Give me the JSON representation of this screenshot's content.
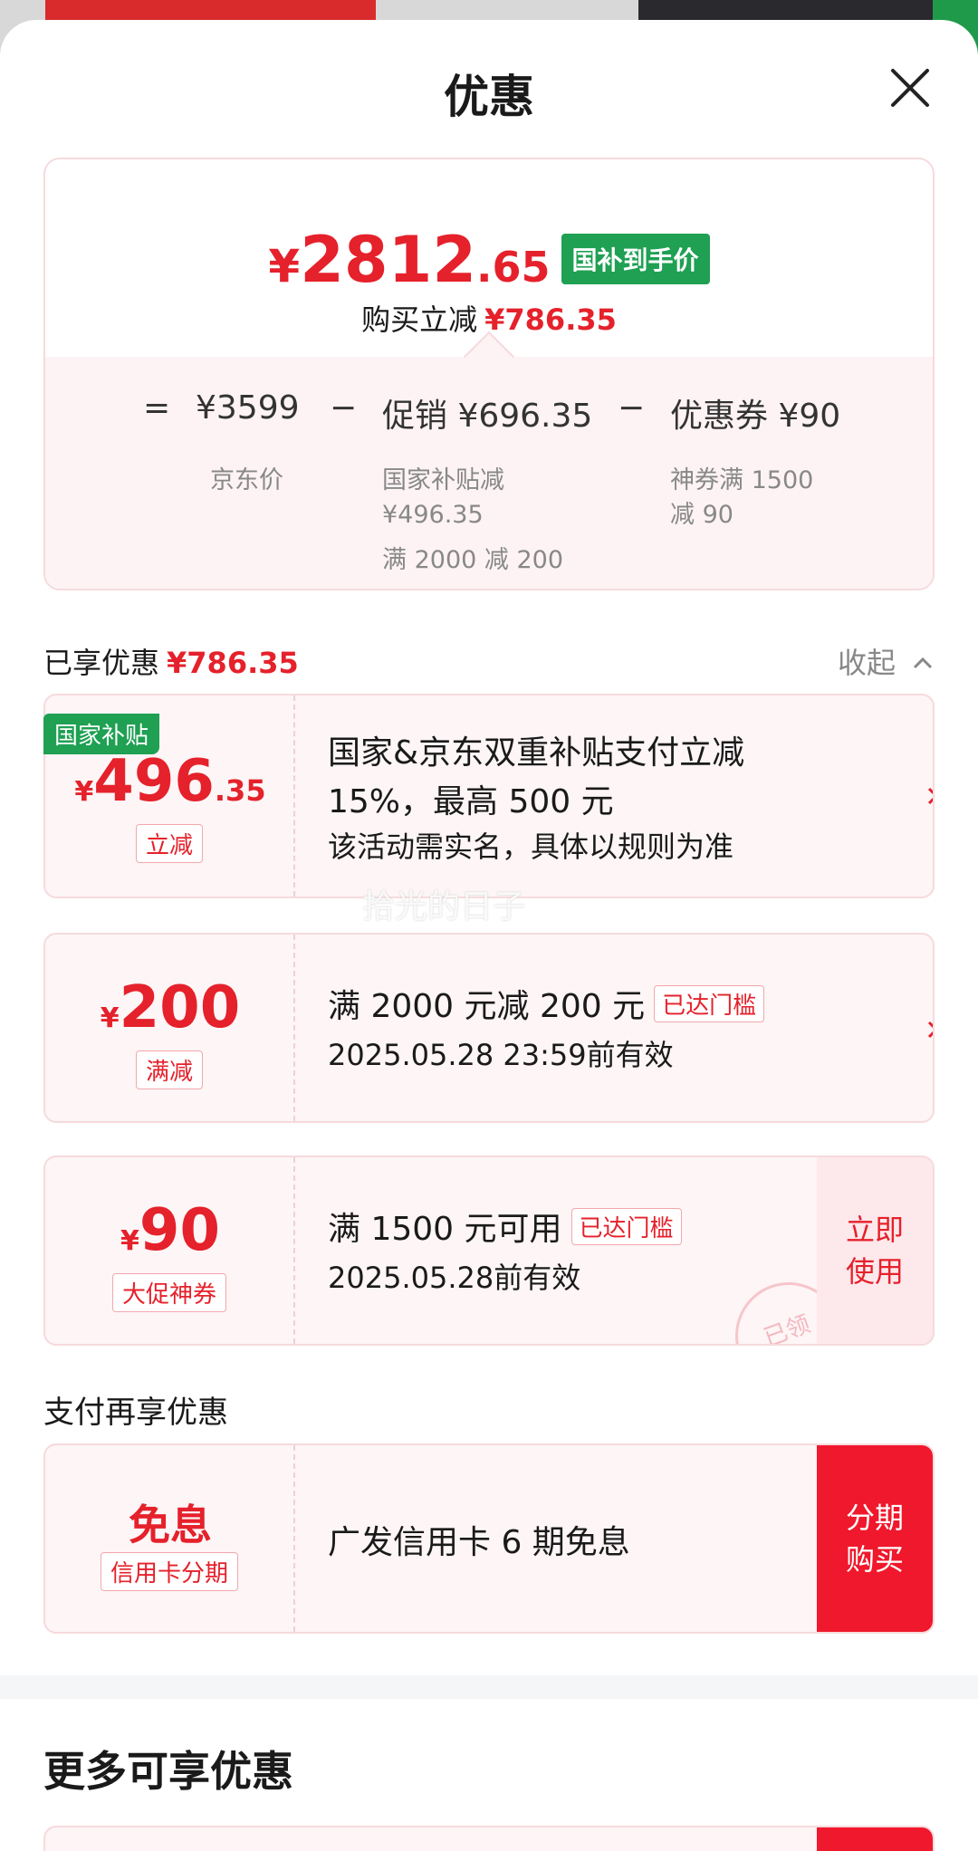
{
  "header": {
    "title": "优惠"
  },
  "summary": {
    "price_symbol": "¥",
    "price_int": "2812",
    "price_dec": ".65",
    "price_tag": "国补到手价",
    "save_label": "购买立减",
    "save_value": "¥786.35",
    "formula": {
      "equals": "=",
      "jd_price": "¥3599",
      "jd_price_label": "京东价",
      "minus1": "−",
      "promo": "促销 ¥696.35",
      "promo_sub1": "国家补贴减",
      "promo_sub2": "¥496.35",
      "promo_sub3": "满 2000 减 200",
      "minus2": "−",
      "coupon": "优惠券 ¥90",
      "coupon_sub1": "神券满 1500",
      "coupon_sub2": "减 90"
    }
  },
  "received": {
    "title": "已享优惠",
    "value": "¥786.35",
    "collapse_label": "收起"
  },
  "coupons": [
    {
      "corner_tag": "国家补贴",
      "symbol": "¥",
      "int": "496",
      "dec": ".35",
      "badge": "立减",
      "line1": "国家&京东双重补贴支付立减",
      "line2": "15%，最高 500 元",
      "line3": "该活动需实名，具体以规则为准"
    },
    {
      "symbol": "¥",
      "int": "200",
      "badge": "满减",
      "line1": "满 2000 元减 200 元",
      "reached": "已达门槛",
      "line2": "2025.05.28 23:59前有效"
    },
    {
      "symbol": "¥",
      "int": "90",
      "badge": "大促神券",
      "line1": "满 1500 元可用",
      "reached": "已达门槛",
      "line2": "2025.05.28前有效",
      "action_line1": "立即",
      "action_line2": "使用",
      "stamp": "已领"
    }
  ],
  "payment": {
    "section_title": "支付再享优惠",
    "value": "免息",
    "badge": "信用卡分期",
    "text": "广发信用卡 6 期免息",
    "action_line1": "分期",
    "action_line2": "购买"
  },
  "more": {
    "title": "更多可享优惠"
  },
  "watermark": "拾光的日子",
  "colors": {
    "accent": "#e5212b",
    "green": "#1fa053",
    "button_red": "#f0182c"
  }
}
